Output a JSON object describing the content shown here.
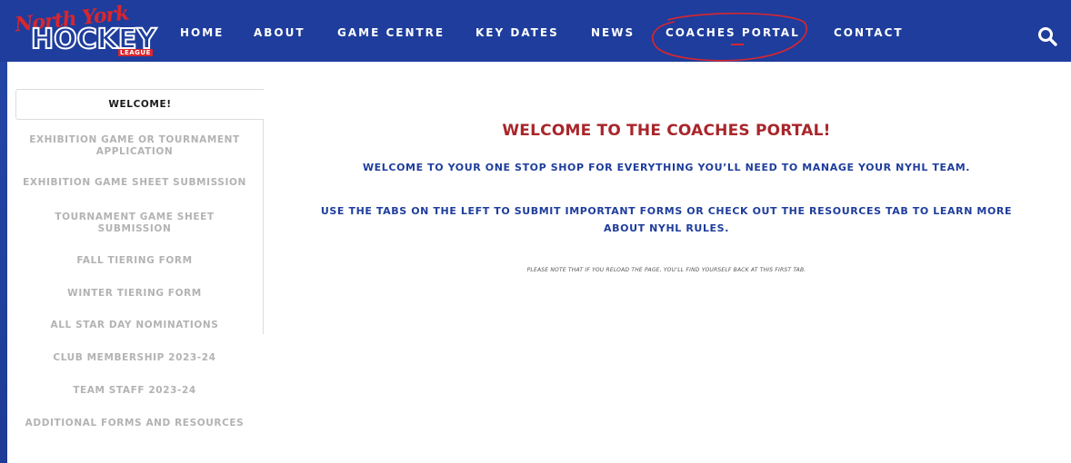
{
  "logo": {
    "script_text": "North York",
    "main_text": "HOCKEY",
    "sub_text": "LEAGUE"
  },
  "nav": {
    "items": [
      {
        "label": "HOME"
      },
      {
        "label": "ABOUT"
      },
      {
        "label": "GAME CENTRE"
      },
      {
        "label": "KEY DATES"
      },
      {
        "label": "NEWS"
      },
      {
        "label": "COACHES PORTAL",
        "active": true
      },
      {
        "label": "CONTACT"
      }
    ],
    "search_icon": "search-icon"
  },
  "tabs": {
    "active": "WELCOME!",
    "items": [
      {
        "line1": "EXHIBITION GAME OR TOURNAMENT",
        "line2": "APPLICATION"
      },
      {
        "line1": "EXHIBITION GAME SHEET SUBMISSION"
      },
      {
        "line1": "TOURNAMENT GAME SHEET",
        "line2": "SUBMISSION"
      },
      {
        "line1": "FALL TIERING FORM"
      },
      {
        "line1": "WINTER TIERING FORM"
      },
      {
        "line1": "ALL STAR DAY NOMINATIONS"
      },
      {
        "line1": "CLUB MEMBERSHIP 2023-24"
      },
      {
        "line1": "TEAM STAFF 2023-24"
      },
      {
        "line1": "ADDITIONAL FORMS AND RESOURCES"
      }
    ]
  },
  "panel": {
    "title": "WELCOME TO THE COACHES PORTAL!",
    "intro": "WELCOME TO YOUR ONE STOP SHOP FOR EVERYTHING YOU’LL NEED TO MANAGE YOUR NYHL TEAM.",
    "instructions_line1": "USE THE TABS ON THE LEFT TO SUBMIT IMPORTANT FORMS OR CHECK OUT THE RESOURCES TAB TO LEARN MORE",
    "instructions_line2": "ABOUT NYHL RULES.",
    "note": "PLEASE NOTE THAT IF YOU RELOAD THE PAGE, YOU’LL FIND YOURSELF BACK AT THIS FIRST TAB."
  },
  "colors": {
    "nav_bg": "#1e3d9c",
    "accent_red": "#d9262e",
    "title_red": "#a8262b",
    "body_blue": "#1e3d9c",
    "tab_gray": "#b3b3b3"
  }
}
